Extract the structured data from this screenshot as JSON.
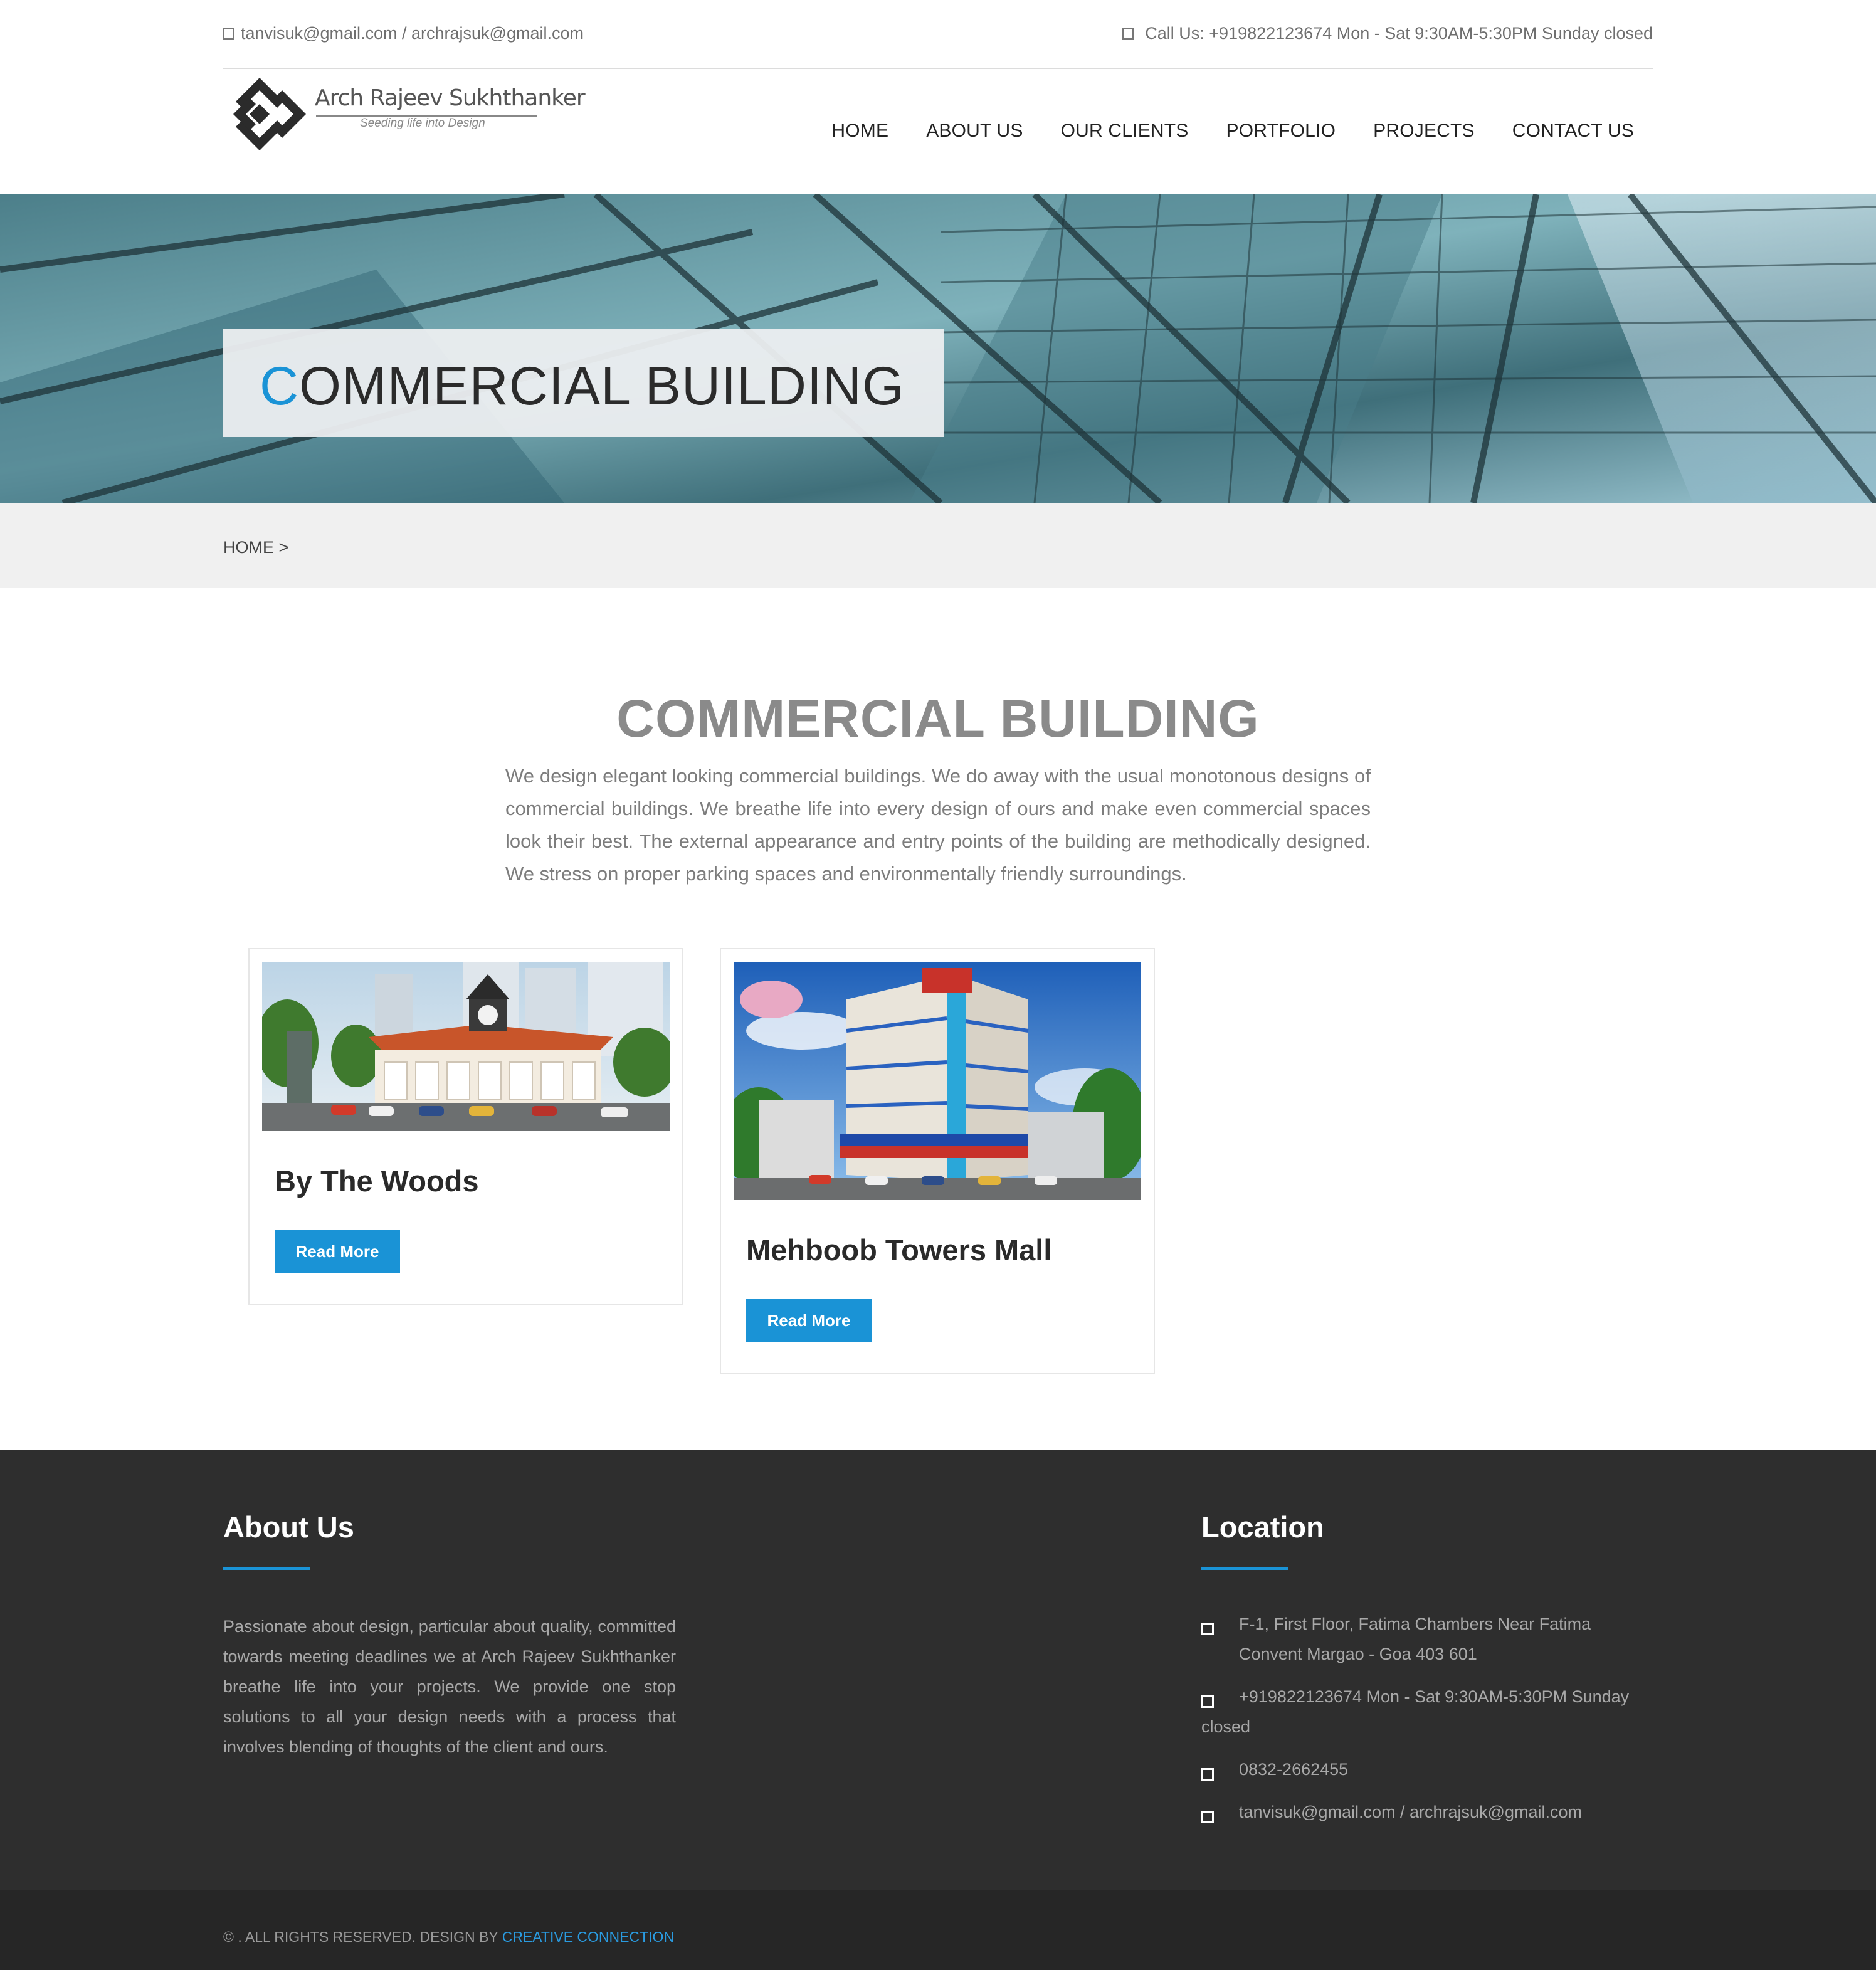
{
  "topbar": {
    "email": "tanvisuk@gmail.com / archrajsuk@gmail.com",
    "call": "Call Us: +919822123674 Mon - Sat 9:30AM-5:30PM Sunday closed"
  },
  "logo": {
    "name": "Arch Rajeev Sukhthanker",
    "tagline": "Seeding life into Design"
  },
  "nav": [
    "HOME",
    "ABOUT US",
    "OUR CLIENTS",
    "PORTFOLIO",
    "PROJECTS",
    "CONTACT US"
  ],
  "banner": {
    "first_letter": "C",
    "rest": "OMMERCIAL BUILDING"
  },
  "breadcrumb": "HOME >",
  "intro": {
    "title": "COMMERCIAL BUILDING",
    "text": "We design elegant looking commercial buildings. We do away with the usual monotonous designs of commercial buildings. We breathe life into every design of ours and make even commercial spaces look their best. The external appearance and entry points of the building are methodically designed. We stress on proper parking spaces and environmentally friendly surroundings."
  },
  "projects": [
    {
      "title": "By The Woods",
      "button": "Read More"
    },
    {
      "title": "Mehboob Towers Mall",
      "button": "Read More"
    }
  ],
  "footer": {
    "about_heading": "About Us",
    "about_text": "Passionate about design, particular about quality, committed towards meeting deadlines we at Arch Rajeev Sukhthanker breathe life into your projects. We provide one stop solutions to all your design needs with a process that involves blending of thoughts of the client and ours.",
    "location_heading": "Location",
    "address": "F-1, First Floor, Fatima Chambers Near Fatima Convent Margao - Goa 403 601",
    "phone": "+919822123674 Mon - Sat 9:30AM-5:30PM Sunday closed",
    "landline": "0832-2662455",
    "email": "tanvisuk@gmail.com / archrajsuk@gmail.com"
  },
  "copyright": {
    "prefix": "© . ALL RIGHTS RESERVED. DESIGN BY",
    "link": "CREATIVE CONNECTION"
  },
  "colors": {
    "accent": "#1a93d6",
    "footer_bg": "#2e2e2e",
    "bottom_bg": "#262626",
    "breadcrumb_bg": "#f0f0f0"
  }
}
